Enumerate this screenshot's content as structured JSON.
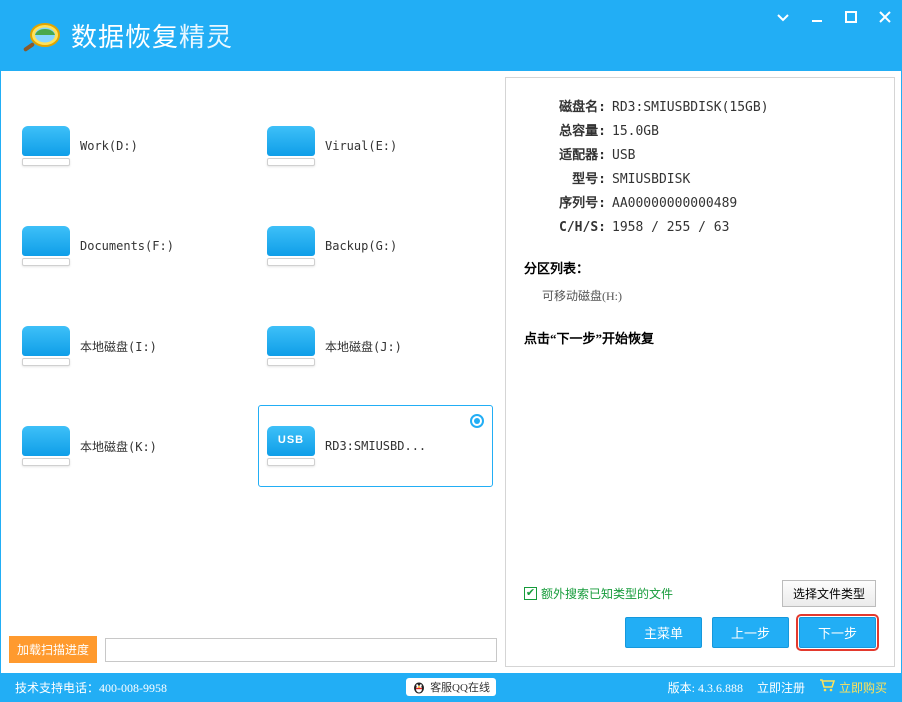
{
  "app": {
    "title1": "数据恢复",
    "title2": "精灵"
  },
  "disks": [
    {
      "label": "Work(D:)",
      "usb": false,
      "selected": false
    },
    {
      "label": "Virual(E:)",
      "usb": false,
      "selected": false
    },
    {
      "label": "Documents(F:)",
      "usb": false,
      "selected": false
    },
    {
      "label": "Backup(G:)",
      "usb": false,
      "selected": false
    },
    {
      "label": "本地磁盘(I:)",
      "usb": false,
      "selected": false
    },
    {
      "label": "本地磁盘(J:)",
      "usb": false,
      "selected": false
    },
    {
      "label": "本地磁盘(K:)",
      "usb": false,
      "selected": false
    },
    {
      "label": "RD3:SMIUSBD...",
      "usb": true,
      "selected": true
    }
  ],
  "load": {
    "button": "加载扫描进度",
    "value": ""
  },
  "info": {
    "labels": {
      "name": "磁盘名:",
      "size": "总容量:",
      "adapter": "适配器:",
      "model": "型号:",
      "serial": "序列号:",
      "chs": "C/H/S:"
    },
    "name": "RD3:SMIUSBDISK(15GB)",
    "size": "15.0GB",
    "adapter": "USB",
    "model": "SMIUSBDISK",
    "serial": "AA00000000000489",
    "chs": "1958 / 255 / 63"
  },
  "partition": {
    "title": "分区列表：",
    "item": "可移动磁盘(H:)"
  },
  "hint": "点击“下一步”开始恢复",
  "extra": {
    "checkbox_label": "额外搜索已知类型的文件",
    "file_type_button": "选择文件类型"
  },
  "nav": {
    "main_menu": "主菜单",
    "prev": "上一步",
    "next": "下一步"
  },
  "status": {
    "support": "技术支持电话：400-008-9958",
    "qq": "客服QQ在线",
    "version_label": "版本:",
    "version": "4.3.6.888",
    "register": "立即注册",
    "buy": "立即购买"
  }
}
